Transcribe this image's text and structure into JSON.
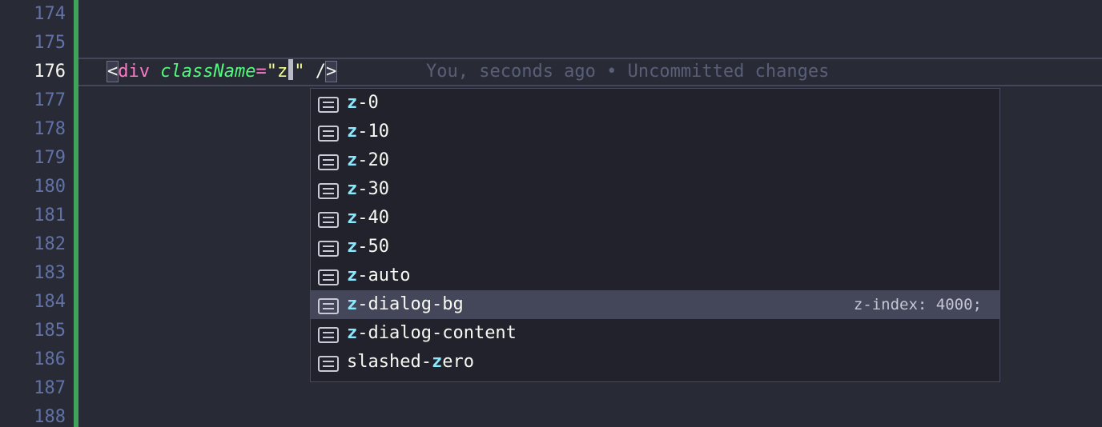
{
  "gutter": {
    "lines": [
      "174",
      "175",
      "176",
      "177",
      "178",
      "179",
      "180",
      "181",
      "182",
      "183",
      "184",
      "185",
      "186",
      "187",
      "188"
    ],
    "active_line": "176"
  },
  "code_line": {
    "open": "<",
    "tag": "div",
    "attr": "className",
    "eq": "=",
    "quote_open": "\"",
    "value": "z",
    "quote_close": "\"",
    "space": " ",
    "slash": "/",
    "close": ">"
  },
  "blame": "You, seconds ago • Uncommitted changes",
  "suggest": {
    "items": [
      {
        "pre": "",
        "match": "z",
        "post": "-0",
        "detail": ""
      },
      {
        "pre": "",
        "match": "z",
        "post": "-10",
        "detail": ""
      },
      {
        "pre": "",
        "match": "z",
        "post": "-20",
        "detail": ""
      },
      {
        "pre": "",
        "match": "z",
        "post": "-30",
        "detail": ""
      },
      {
        "pre": "",
        "match": "z",
        "post": "-40",
        "detail": ""
      },
      {
        "pre": "",
        "match": "z",
        "post": "-50",
        "detail": ""
      },
      {
        "pre": "",
        "match": "z",
        "post": "-auto",
        "detail": ""
      },
      {
        "pre": "",
        "match": "z",
        "post": "-dialog-bg",
        "detail": "z-index: 4000;"
      },
      {
        "pre": "",
        "match": "z",
        "post": "-dialog-content",
        "detail": ""
      },
      {
        "pre": "slashed-",
        "match": "z",
        "post": "ero",
        "detail": ""
      }
    ],
    "selected_index": 7,
    "item_icon": "text-snippet-icon"
  },
  "colors": {
    "background": "#282a36",
    "git_added": "#3fa35c",
    "match": "#8be9fd",
    "selected_row": "#44475a"
  }
}
